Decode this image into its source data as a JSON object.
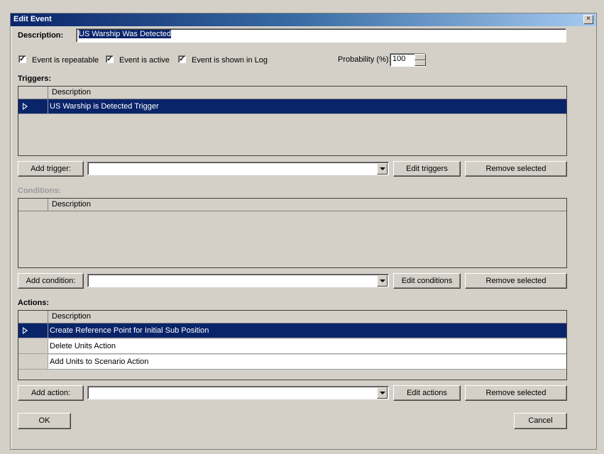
{
  "window": {
    "title": "Edit Event",
    "close_glyph": "×"
  },
  "description": {
    "label": "Description:",
    "value": "US Warship Was Detected"
  },
  "options": {
    "repeatable": {
      "label": "Event is repeatable",
      "checked": true
    },
    "active": {
      "label": "Event is active",
      "checked": true
    },
    "shown_in_log": {
      "label": "Event is shown in Log",
      "checked": true
    },
    "check_glyph": "✓",
    "probability_label": "Probability (%):",
    "probability_value": "100"
  },
  "triggers": {
    "heading": "Triggers:",
    "column": "Description",
    "rows": [
      "US Warship is Detected Trigger"
    ],
    "add_label": "Add trigger:",
    "combo_value": "",
    "edit_label": "Edit triggers",
    "remove_label": "Remove selected"
  },
  "conditions": {
    "heading": "Conditions:",
    "column": "Description",
    "rows": [],
    "add_label": "Add condition:",
    "combo_value": "",
    "edit_label": "Edit conditions",
    "remove_label": "Remove selected"
  },
  "actions": {
    "heading": "Actions:",
    "column": "Description",
    "rows": [
      "Create Reference Point for Initial Sub Position",
      "Delete Units Action",
      "Add Units to Scenario Action"
    ],
    "add_label": "Add action:",
    "combo_value": "",
    "edit_label": "Edit actions",
    "remove_label": "Remove selected"
  },
  "footer": {
    "ok_label": "OK",
    "cancel_label": "Cancel"
  }
}
